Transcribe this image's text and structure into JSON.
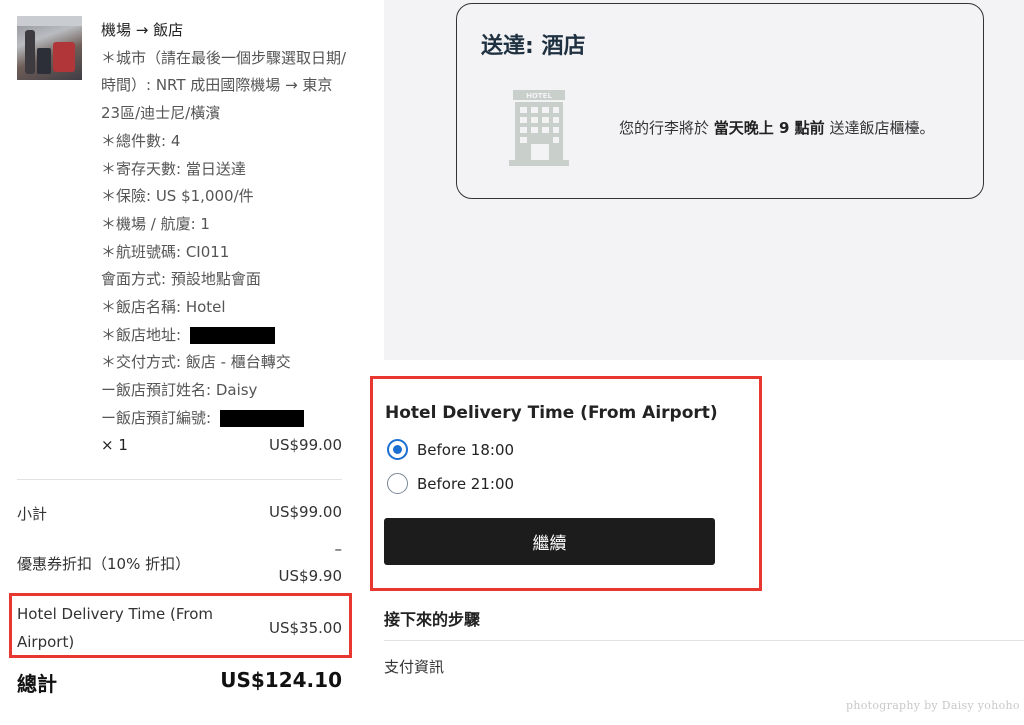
{
  "order_item": {
    "title": "機場 → 飯店",
    "lines": [
      "＊城市（請在最後一個步驟選取日期/時間）: NRT 成田國際機場 → 東京23區/迪士尼/橫濱",
      "＊總件數: 4",
      "＊寄存天數: 當日送達",
      "＊保險: US $1,000/件",
      "＊機場 / 航廈: 1",
      "＊航班號碼: CI011",
      "會面方式: 預設地點會面",
      "＊飯店名稱: Hotel",
      "＊飯店地址:",
      "＊交付方式: 飯店 - 櫃台轉交",
      "ー飯店預訂姓名: Daisy",
      "ー飯店預訂編號:"
    ],
    "quantity": "× 1",
    "price": "US$99.00"
  },
  "summary": {
    "subtotal_label": "小計",
    "subtotal_value": "US$99.00",
    "coupon_label": "優惠券折扣（10% 折扣）",
    "coupon_sign": "–",
    "coupon_value": "US$9.90",
    "delivery_label": "Hotel Delivery Time (From Airport)",
    "delivery_value": "US$35.00",
    "total_label": "總計",
    "total_value": "US$124.10"
  },
  "delivery_card": {
    "title": "送達: 酒店",
    "icon_text": "HOTEL",
    "message_prefix": "您的行李將於",
    "message_bold": "當天晚上 9 點前",
    "message_suffix": "送達飯店櫃檯。"
  },
  "delivery_time": {
    "title": "Hotel Delivery Time (From Airport)",
    "options": [
      {
        "label": "Before 18:00",
        "selected": true
      },
      {
        "label": "Before 21:00",
        "selected": false
      }
    ],
    "continue_label": "繼續"
  },
  "next_steps": {
    "title": "接下來的步驟",
    "items": [
      "支付資訊"
    ]
  },
  "watermark": "photography by Daisy yohoho",
  "colors": {
    "highlight": "#e8372f",
    "radio_selected": "#1a6fd1",
    "button_bg": "#1c1c1c",
    "panel_bg": "#f3f3f5",
    "card_title": "#1f3140"
  },
  "icons": {
    "hotel": "hotel-building-icon",
    "product": "luggage-photo"
  }
}
